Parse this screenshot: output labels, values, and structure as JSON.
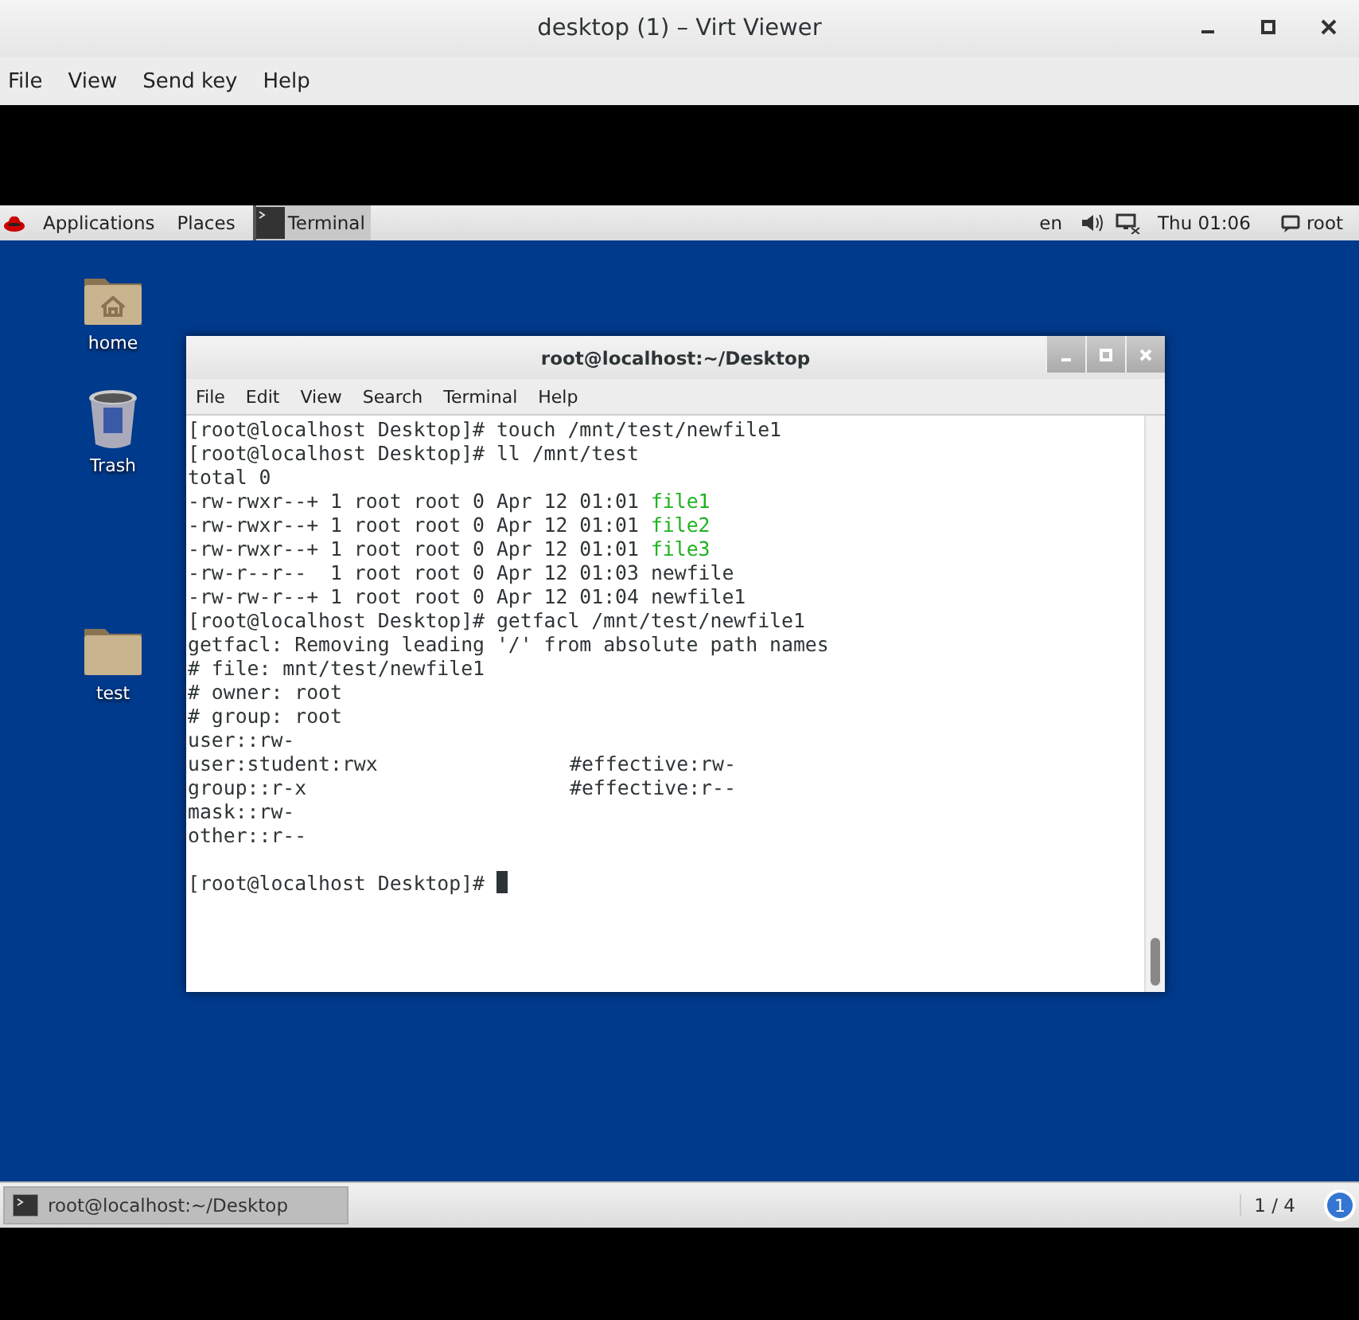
{
  "window": {
    "title": "desktop (1) – Virt Viewer"
  },
  "menu": [
    "File",
    "View",
    "Send key",
    "Help"
  ],
  "top_bar": {
    "applications": "Applications",
    "places": "Places",
    "active_app": "Terminal",
    "language": "en",
    "clock": "Thu 01:06",
    "user": "root"
  },
  "desktop_icons": [
    {
      "label": "home",
      "kind": "home"
    },
    {
      "label": "Trash",
      "kind": "trash"
    },
    {
      "label": "test",
      "kind": "folder"
    }
  ],
  "terminal": {
    "title": "root@localhost:~/Desktop",
    "menu": [
      "File",
      "Edit",
      "View",
      "Search",
      "Terminal",
      "Help"
    ],
    "lines": [
      {
        "kind": "text",
        "text": "[root@localhost Desktop]# touch /mnt/test/newfile1"
      },
      {
        "kind": "text",
        "text": "[root@localhost Desktop]# ll /mnt/test"
      },
      {
        "kind": "text",
        "text": "total 0"
      },
      {
        "kind": "entry",
        "info": "-rw-rwxr--+ 1 root root 0 Apr 12 01:01",
        "name": "file1",
        "executable": true
      },
      {
        "kind": "entry",
        "info": "-rw-rwxr--+ 1 root root 0 Apr 12 01:01",
        "name": "file2",
        "executable": true
      },
      {
        "kind": "entry",
        "info": "-rw-rwxr--+ 1 root root 0 Apr 12 01:01",
        "name": "file3",
        "executable": true
      },
      {
        "kind": "entry",
        "info": "-rw-r--r--  1 root root 0 Apr 12 01:03",
        "name": "newfile",
        "executable": false
      },
      {
        "kind": "entry",
        "info": "-rw-rw-r--+ 1 root root 0 Apr 12 01:04",
        "name": "newfile1",
        "executable": false
      },
      {
        "kind": "text",
        "text": "[root@localhost Desktop]# getfacl /mnt/test/newfile1"
      },
      {
        "kind": "text",
        "text": "getfacl: Removing leading '/' from absolute path names"
      },
      {
        "kind": "text",
        "text": "# file: mnt/test/newfile1"
      },
      {
        "kind": "text",
        "text": "# owner: root"
      },
      {
        "kind": "text",
        "text": "# group: root"
      },
      {
        "kind": "text",
        "text": "user::rw-"
      },
      {
        "kind": "acl",
        "entry": "user:student:rwx",
        "effective": "#effective:rw-"
      },
      {
        "kind": "acl",
        "entry": "group::r-x",
        "effective": "#effective:r--"
      },
      {
        "kind": "text",
        "text": "mask::rw-"
      },
      {
        "kind": "text",
        "text": "other::r--"
      },
      {
        "kind": "blank"
      },
      {
        "kind": "prompt",
        "text": "[root@localhost Desktop]#"
      }
    ]
  },
  "bottom_bar": {
    "task": "root@localhost:~/Desktop",
    "workspace": "1 / 4",
    "notifications": "1"
  }
}
